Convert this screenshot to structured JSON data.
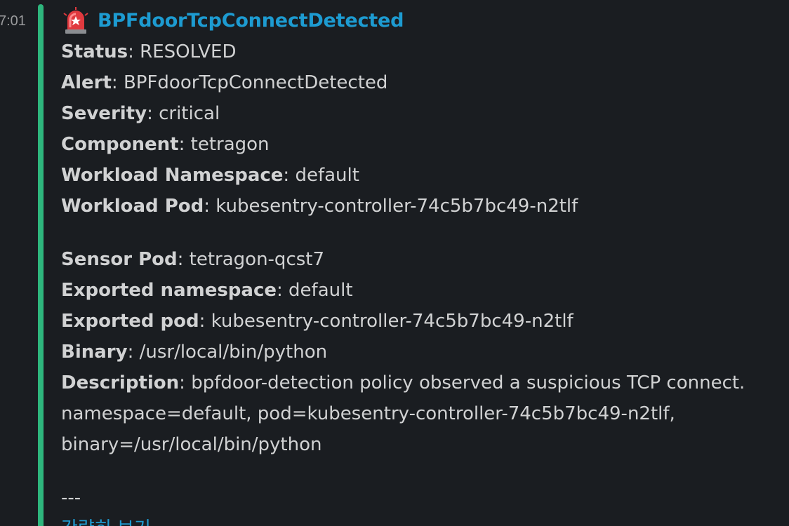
{
  "timestamp": "7:01",
  "alert": {
    "icon": "rotating-light-icon",
    "title": "BPFdoorTcpConnectDetected",
    "fields_group1": [
      {
        "key": "Status",
        "value": "RESOLVED"
      },
      {
        "key": "Alert",
        "value": "BPFdoorTcpConnectDetected"
      },
      {
        "key": "Severity",
        "value": "critical"
      },
      {
        "key": "Component",
        "value": "tetragon"
      },
      {
        "key": "Workload Namespace",
        "value": "default"
      },
      {
        "key": "Workload Pod",
        "value": "kubesentry-controller-74c5b7bc49-n2tlf"
      }
    ],
    "fields_group2": [
      {
        "key": "Sensor Pod",
        "value": "tetragon-qcst7"
      },
      {
        "key": "Exported namespace",
        "value": "default"
      },
      {
        "key": "Exported pod",
        "value": "kubesentry-controller-74c5b7bc49-n2tlf"
      },
      {
        "key": "Binary",
        "value": "/usr/local/bin/python"
      }
    ],
    "description": {
      "key": "Description",
      "line1": "bpfdoor-detection policy observed a suspicious TCP connect.",
      "line2": "namespace=default, pod=kubesentry-controller-74c5b7bc49-n2tlf,",
      "line3": "binary=/usr/local/bin/python"
    },
    "separator": "---",
    "link_label": "간략히 보기"
  },
  "colors": {
    "background": "#1a1d21",
    "attachment_bar": "#2eb67d",
    "link": "#1d9bd1",
    "text": "#d1d2d3"
  }
}
